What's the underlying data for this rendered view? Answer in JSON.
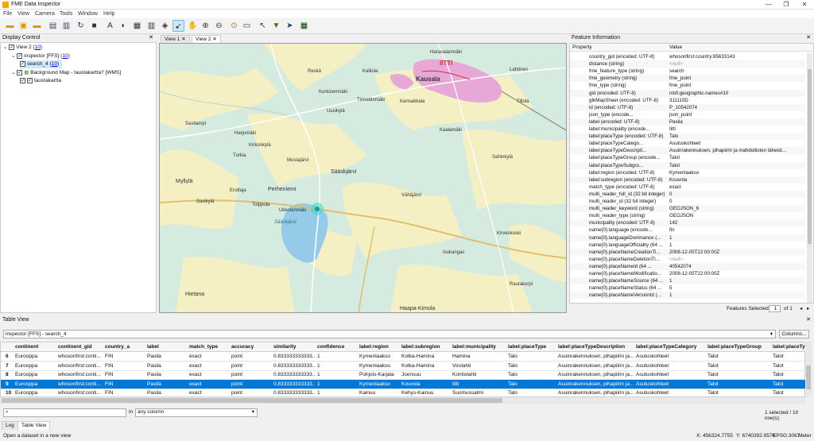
{
  "window": {
    "title": "FME Data Inspector",
    "minimize": "—",
    "maximize": "❐",
    "close": "✕"
  },
  "menu": [
    "File",
    "View",
    "Camera",
    "Tools",
    "Window",
    "Help"
  ],
  "toolbar_icons": [
    "open-icon",
    "new-icon",
    "folder-icon",
    "save-icon",
    "export-icon",
    "refresh-icon",
    "stop-icon",
    "text-icon",
    "paint-icon",
    "table-icon",
    "columns-icon",
    "layers-icon",
    "select-icon",
    "pan-icon",
    "zoom-in-icon",
    "zoom-out-icon",
    "zoom-extent-icon",
    "measure-icon",
    "cursor-icon",
    "filter-icon",
    "navigate-icon",
    "grid-icon"
  ],
  "display_control": {
    "title": "Display Control",
    "items": [
      {
        "label": "View 2",
        "count": "10"
      },
      {
        "label": "inspector [FFS]",
        "count": "10"
      },
      {
        "label": "search_4",
        "count": "10"
      },
      {
        "label": "Background Map - taustakartta? [WMS]"
      },
      {
        "label": "taustakartta"
      }
    ]
  },
  "view_tabs": [
    {
      "label": "View 1"
    },
    {
      "label": "View 2"
    }
  ],
  "map": {
    "labels": {
      "haravalanmaki": "Haravalanmäki",
      "iittala": "IITTI",
      "kausala": "Kausala",
      "reska": "Reskä",
      "kalliola": "Kalliola",
      "lahtinen": "Lahtinen",
      "kurkisenmaki": "Kurkisenmäki",
      "tinnelanmaki": "Tinnelänmäki",
      "kannakkala": "Kannakkala",
      "uusikyla": "Uusikylä",
      "savilampi": "Savilampi",
      "kaalamaki": "Kaalamäki",
      "tillola": "Tillola",
      "sahinkyla": "Sahinkylä",
      "harjumaki": "Harjumäki",
      "kirkonkyla": "Kirkonkylä",
      "turkia": "Turkia",
      "myllyla": "Myllylä",
      "perheniemi": "Perheniemi",
      "saaskjarvi": "Sääskjärvi",
      "mustajarvi": "Mustajärvi",
      "erottaja": "Erottaja",
      "savikyla": "Savikylä",
      "tolppola": "Tolppola",
      "ukkolanmaki": "Ukkolanmäki",
      "saaskjarvi_lake": "Sääskjärvi",
      "vahajarvi": "Vähäjärvi",
      "kirveskoski": "Kirveskoski",
      "hietana": "Hietana",
      "haapakimola": "Haapa-Kimola",
      "isokangas": "Isokangas",
      "rautakorpi": "Rautakorpi"
    }
  },
  "feature_info": {
    "title": "Feature Information",
    "col_property": "Property",
    "col_value": "Value",
    "rows": [
      {
        "p": "country_gid (encoded: UTF-8)",
        "v": "whosonfirst:country:85633143"
      },
      {
        "p": "distance (string)",
        "v": "<null>"
      },
      {
        "p": "fme_feature_type (string)",
        "v": "search"
      },
      {
        "p": "fme_geometry (string)",
        "v": "fme_point"
      },
      {
        "p": "fme_type (string)",
        "v": "fme_point"
      },
      {
        "p": "gid (encoded: UTF-8)",
        "v": "nlsfi:geographic-names#10"
      },
      {
        "p": "gtkMapSheet (encoded: UTF-8)",
        "v": "311110D"
      },
      {
        "p": "id (encoded: UTF-8)",
        "v": "P_10542074"
      },
      {
        "p": "json_type (encode...",
        "v": "json_point"
      },
      {
        "p": "label (encoded: UTF-8)",
        "v": "Pasila"
      },
      {
        "p": "label:municipality (encode...",
        "v": "Iitti"
      },
      {
        "p": "label:placeType (encoded: UTF-8)",
        "v": "Talo"
      },
      {
        "p": "label:placeTypeCatego...",
        "v": "Asutuskohteet"
      },
      {
        "p": "label:placeTypeDescripti...",
        "v": "Asuinrakennuksen, pihapiirin ja mahdollisten läheist..."
      },
      {
        "p": "label:placeTypeGroup (encode...",
        "v": "Talot"
      },
      {
        "p": "label:placeTypeSubgro...",
        "v": "Talot"
      },
      {
        "p": "label:region (encoded: UTF-8)",
        "v": "Kymenlaakso"
      },
      {
        "p": "label:subregion (encoded: UTF-8)",
        "v": "Kouvola"
      },
      {
        "p": "match_type (encoded: UTF-8)",
        "v": "exact"
      },
      {
        "p": "multi_reader_full_id (32 bit integer)",
        "v": "0"
      },
      {
        "p": "multi_reader_id (32 bit integer)",
        "v": "0"
      },
      {
        "p": "multi_reader_keyword (string)",
        "v": "GEOJSON_6"
      },
      {
        "p": "multi_reader_type (string)",
        "v": "GEOJSON"
      },
      {
        "p": "municipality (encoded: UTF-8)",
        "v": "142"
      },
      {
        "p": "name{0}.language (encode...",
        "v": "fin"
      },
      {
        "p": "name{0}.languageDominance (...",
        "v": "1"
      },
      {
        "p": "name{0}.languageOfficiality (64 ...",
        "v": "1"
      },
      {
        "p": "name{0}.placeNameCreationTi...",
        "v": "2008-12-05T22:00:00Z"
      },
      {
        "p": "name{0}.placeNameDeletionTi...",
        "v": "<null>"
      },
      {
        "p": "name{0}.placeNameId (64 ...",
        "v": "40542074"
      },
      {
        "p": "name{0}.placeNameModificatio...",
        "v": "2008-12-05T22:00:00Z"
      },
      {
        "p": "name{0}.placeNameSource (64 ...",
        "v": "1"
      },
      {
        "p": "name{0}.placeNameStatus (64 ...",
        "v": "5"
      },
      {
        "p": "name{0}.placeNameVersionId (...",
        "v": "1"
      }
    ],
    "features_selected_label": "Features Selected:",
    "features_selected_value": "1",
    "of_label": "of 1"
  },
  "table_view": {
    "title": "Table View",
    "source": "inspector [FFS] - search_4",
    "columns_button": "Columns...",
    "headers": [
      "continent",
      "continent_gid",
      "country_a",
      "label",
      "match_type",
      "accuracy",
      "similarity",
      "confidence",
      "label:region",
      "label:subregion",
      "label:municipality",
      "label:placeType",
      "label:placeTypeDescription",
      "label:placeTypeCategory",
      "label:placeTypeGroup",
      "label:placeTy"
    ],
    "rows": [
      {
        "n": "6",
        "cells": [
          "Eurooppa",
          "whosonfirst:conti...",
          "FIN",
          "Pasila",
          "exact",
          "point",
          "0.833333333333...",
          "1",
          "Kymenlaakso",
          "Kotka-Hamina",
          "Hamina",
          "Talo",
          "Asuinrakennuksen, pihapiirin ja...",
          "Asutuskohteet",
          "Talot",
          "Talot"
        ]
      },
      {
        "n": "7",
        "cells": [
          "Eurooppa",
          "whosonfirst:conti...",
          "FIN",
          "Pasila",
          "exact",
          "point",
          "0.833333333333...",
          "1",
          "Kymenlaakso",
          "Kotka-Hamina",
          "Virolahti",
          "Talo",
          "Asuinrakennuksen, pihapiirin ja...",
          "Asutuskohteet",
          "Talot",
          "Talot"
        ]
      },
      {
        "n": "8",
        "cells": [
          "Eurooppa",
          "whosonfirst:conti...",
          "FIN",
          "Pasila",
          "exact",
          "point",
          "0.833333333333...",
          "1",
          "Pohjois-Karjala",
          "Joensuu",
          "Kontiolahti",
          "Talo",
          "Asuinrakennuksen, pihapiirin ja...",
          "Asutuskohteet",
          "Talot",
          "Talot"
        ]
      },
      {
        "n": "9",
        "cells": [
          "Eurooppa",
          "whosonfirst:conti...",
          "FIN",
          "Pasila",
          "exact",
          "point",
          "0.833333333333...",
          "1",
          "Kymenlaakso",
          "Kouvola",
          "Iitti",
          "Talo",
          "Asuinrakennuksen, pihapiirin ja...",
          "Asutuskohteet",
          "Talot",
          "Talot"
        ],
        "selected": true
      },
      {
        "n": "10",
        "cells": [
          "Eurooppa",
          "whosonfirst:conti...",
          "FIN",
          "Pasila",
          "exact",
          "point",
          "0.833333333333...",
          "1",
          "Kainuu",
          "Kehys-Kainuu",
          "Suomussalmi",
          "Talo",
          "Asuinrakennuksen, pihapiirin ja...",
          "Asutuskohteet",
          "Talot",
          "Talot"
        ]
      }
    ],
    "search_in": "in",
    "search_scope": "any column",
    "selection_status": "1 selected / 10 row(s)"
  },
  "bottom_tabs": [
    {
      "label": "Log"
    },
    {
      "label": "Table View"
    }
  ],
  "status": {
    "message": "Open a dataset in a new view",
    "x": "X:  456324.7755",
    "y": "Y:  6740392.9576",
    "epsg": "EPSG:3067",
    "unit": "Meter"
  }
}
